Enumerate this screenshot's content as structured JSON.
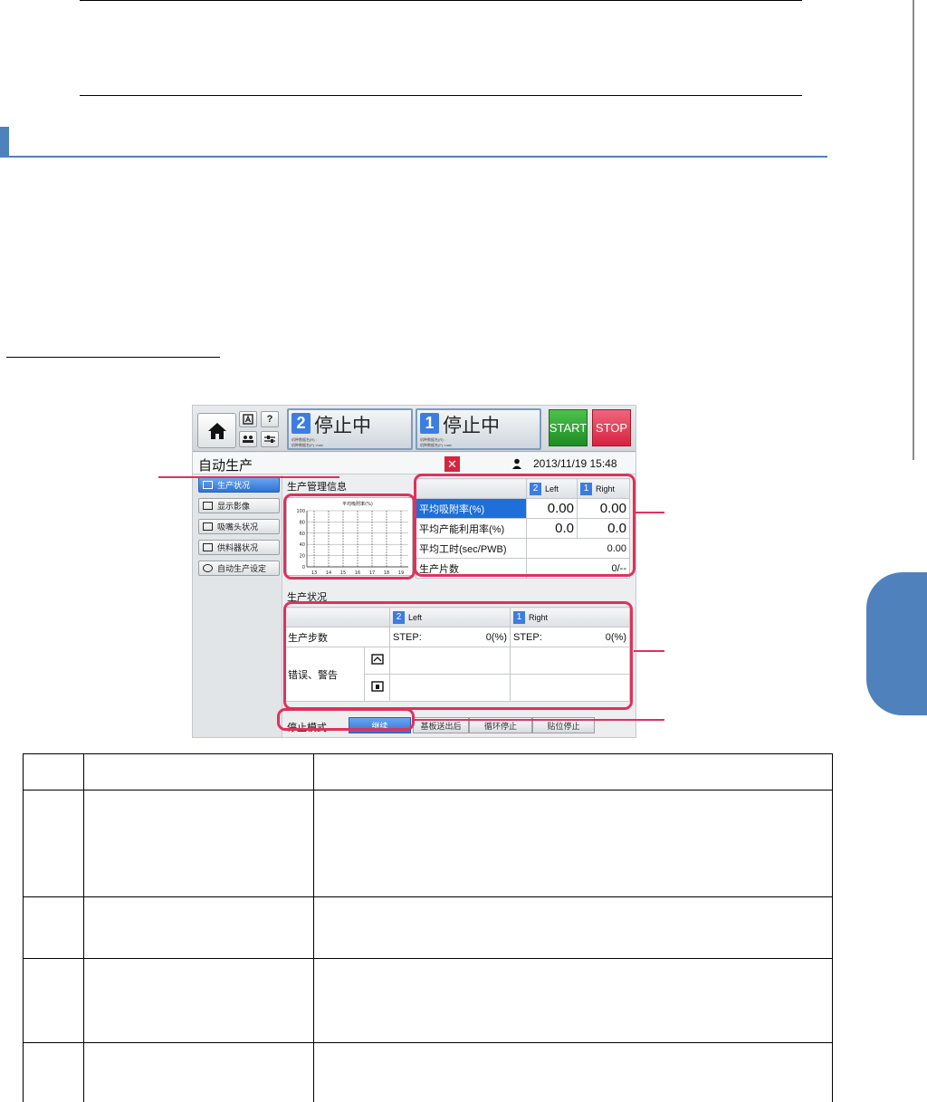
{
  "screenshot": {
    "topbar": {
      "help_label": "?",
      "panel_right": {
        "number": "2",
        "status": "停止中",
        "line1": "机种数据名(R) :",
        "line2": "机种数据名(F) :max"
      },
      "panel_left": {
        "number": "1",
        "status": "停止中",
        "line1": "机种数据名(R) :",
        "line2": "机种数据名(F) :max"
      },
      "start_label": "START",
      "stop_label": "STOP"
    },
    "title_row": {
      "title": "自动生产",
      "close_label": "✕",
      "datetime": "2013/11/19 15:48"
    },
    "nav": {
      "items": [
        {
          "label": "生产状况"
        },
        {
          "label": "显示影像"
        },
        {
          "label": "吸嘴头状况"
        },
        {
          "label": "供料器状况"
        },
        {
          "label": "自动生产设定"
        }
      ]
    },
    "production_info": {
      "section_title": "生产管理信息",
      "chart_title": "平均吸附率(%)",
      "col_left": {
        "number": "2",
        "label": "Left"
      },
      "col_right": {
        "number": "1",
        "label": "Right"
      },
      "rows": [
        {
          "label": "平均吸附率(%)",
          "left": "0.00",
          "right": "0.00"
        },
        {
          "label": "平均产能利用率(%)",
          "left": "0.0",
          "right": "0.0"
        },
        {
          "label": "平均工时(sec/PWB)",
          "value": "0.00"
        },
        {
          "label": "生产片数",
          "value": "0/--"
        }
      ]
    },
    "production_status": {
      "section_title": "生产状况",
      "col_left": {
        "number": "2",
        "label": "Left"
      },
      "col_right": {
        "number": "1",
        "label": "Right"
      },
      "steps_label": "生产步数",
      "step_left_label": "STEP:",
      "step_left_value": "0(%)",
      "step_right_label": "STEP:",
      "step_right_value": "0(%)",
      "errors_label": "错误、警告"
    },
    "stop_mode": {
      "label": "停止模式",
      "buttons": [
        "继续",
        "基板送出后",
        "循环停止",
        "贴位停止"
      ]
    }
  },
  "chart_data": {
    "type": "bar",
    "title": "平均吸附率(%)",
    "categories": [
      "13",
      "14",
      "15",
      "16",
      "17",
      "18",
      "19"
    ],
    "values": [
      0,
      0,
      0,
      0,
      0,
      0,
      0
    ],
    "xlabel": "",
    "ylabel": "",
    "ylim": [
      0,
      100
    ],
    "yticks": [
      "0",
      "20",
      "40",
      "60",
      "80",
      "100"
    ],
    "grid": true
  }
}
